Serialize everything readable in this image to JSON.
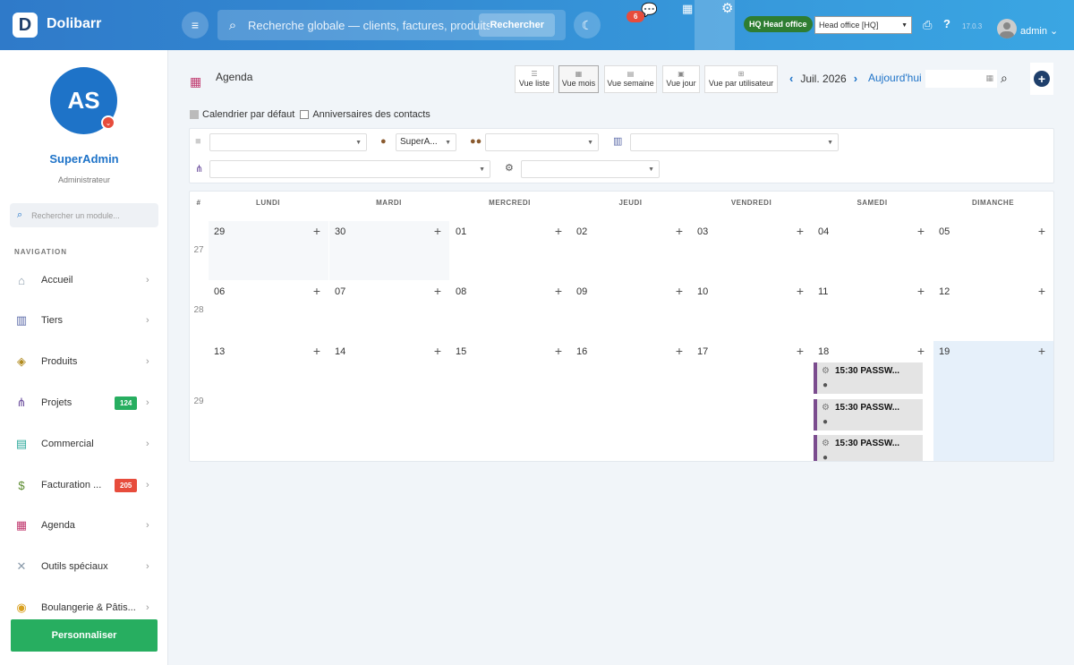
{
  "app": {
    "logo_letter": "D",
    "name": "Dolibarr"
  },
  "topbar": {
    "search_placeholder": "Recherche globale — clients, factures, produits...",
    "search_button": "Rechercher",
    "notif_count": "6",
    "hq_badge": "HQ Head office",
    "entity_select": "Head office [HQ]",
    "version": "17.0.3",
    "user": "admin"
  },
  "sidebar": {
    "avatar_initials": "AS",
    "user_name": "SuperAdmin",
    "user_role": "Administrateur",
    "module_search_placeholder": "Rechercher un module...",
    "nav_title": "NAVIGATION",
    "items": [
      {
        "label": "Accueil",
        "icon": "home-icon",
        "badge": ""
      },
      {
        "label": "Tiers",
        "icon": "building-icon",
        "badge": ""
      },
      {
        "label": "Produits",
        "icon": "box-icon",
        "badge": ""
      },
      {
        "label": "Projets",
        "icon": "project-icon",
        "badge": "124"
      },
      {
        "label": "Commercial",
        "icon": "briefcase-icon",
        "badge": ""
      },
      {
        "label": "Facturation ...",
        "icon": "invoice-icon",
        "badge": "205"
      },
      {
        "label": "Agenda",
        "icon": "calendar-icon",
        "badge": ""
      },
      {
        "label": "Outils spéciaux",
        "icon": "tools-icon",
        "badge": ""
      },
      {
        "label": "Boulangerie & Pâtis...",
        "icon": "bread-icon",
        "badge": ""
      }
    ],
    "customize_button": "Personnaliser"
  },
  "agenda": {
    "title": "Agenda",
    "views": [
      "Vue liste",
      "Vue mois",
      "Vue semaine",
      "Vue jour",
      "Vue par utilisateur"
    ],
    "active_view": "Vue mois",
    "month_label": "Juil. 2026",
    "today_label": "Aujourd'hui",
    "checkbox_default_calendar": "Calendrier par défaut",
    "checkbox_birthdays": "Anniversaires des contacts",
    "user_filter_value": "SuperA..."
  },
  "calendar": {
    "week_col_header": "#",
    "days": [
      "LUNDI",
      "MARDI",
      "MERCREDI",
      "JEUDI",
      "VENDREDI",
      "SAMEDI",
      "DIMANCHE"
    ],
    "weeks": [
      {
        "num": "27",
        "dates": [
          "29",
          "30",
          "01",
          "02",
          "03",
          "04",
          "05"
        ]
      },
      {
        "num": "28",
        "dates": [
          "06",
          "07",
          "08",
          "09",
          "10",
          "11",
          "12"
        ]
      },
      {
        "num": "29",
        "dates": [
          "13",
          "14",
          "15",
          "16",
          "17",
          "18",
          "19"
        ]
      }
    ],
    "events": [
      {
        "text": "15:30 PASSW..."
      },
      {
        "text": "15:30 PASSW..."
      },
      {
        "text": "15:30 PASSW..."
      }
    ]
  },
  "colors": {
    "accent": "#1e73c8",
    "topbar": "#2f7ac9",
    "badge_green": "#27ae60",
    "badge_red": "#e74c3c",
    "event_border": "#7b4c8e"
  }
}
